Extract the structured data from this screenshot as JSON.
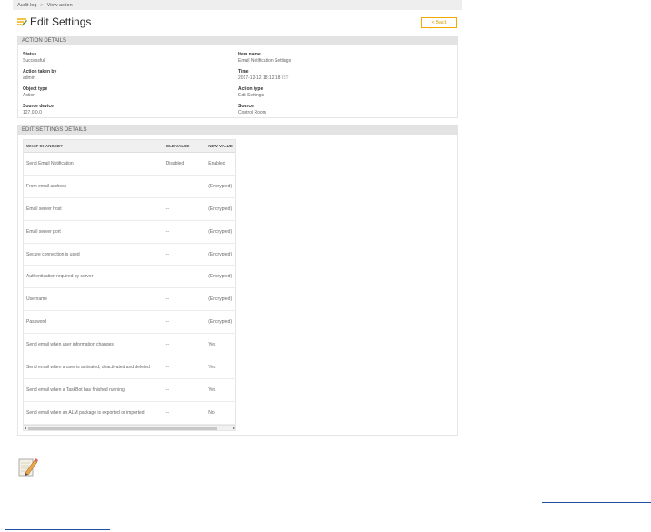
{
  "breadcrumb": {
    "items": [
      "Audit log",
      "View action"
    ],
    "separator": ">"
  },
  "header": {
    "title": "Edit Settings",
    "back_label": "< Back"
  },
  "action_details": {
    "header": "ACTION DETAILS",
    "left": [
      {
        "label": "Status",
        "value": "Successful"
      },
      {
        "label": "Action taken by",
        "value": "admin"
      },
      {
        "label": "Object type",
        "value": "Action"
      },
      {
        "label": "Source device",
        "value": "127.0.0.0"
      }
    ],
    "right": [
      {
        "label": "Item name",
        "value": "Email Notification Settings"
      },
      {
        "label": "Time",
        "value": "2017-12-12 18:12:18",
        "tz": "IST"
      },
      {
        "label": "Action type",
        "value": "Edit Settings"
      },
      {
        "label": "Source",
        "value": "Control Room"
      }
    ]
  },
  "edit_settings": {
    "header": "EDIT SETTINGS DETAILS",
    "columns": [
      "WHAT CHANGED?",
      "OLD VALUE",
      "NEW VALUE"
    ],
    "rows": [
      [
        "Send Email Notification",
        "Disabled",
        "Enabled"
      ],
      [
        "From email address",
        "--",
        "(Encrypted)"
      ],
      [
        "Email server host",
        "--",
        "(Encrypted)"
      ],
      [
        "Email server port",
        "--",
        "(Encrypted)"
      ],
      [
        "Secure connection is used",
        "--",
        "(Encrypted)"
      ],
      [
        "Authentication required by server",
        "--",
        "(Encrypted)"
      ],
      [
        "Username",
        "--",
        "(Encrypted)"
      ],
      [
        "Password",
        "--",
        "(Encrypted)"
      ],
      [
        "Send email when user information changes",
        "--",
        "Yes"
      ],
      [
        "Send email when a user is activated, deactivated and deleted",
        "--",
        "Yes"
      ],
      [
        "Send email when a TaskBot has finished running",
        "--",
        "Yes"
      ],
      [
        "Send email when an ALM package is exported or imported",
        "--",
        "No"
      ]
    ]
  },
  "colors": {
    "accent": "#f2a900",
    "link": "#1f4f9e",
    "section_bg": "#e3e3e3"
  },
  "icons": {
    "title_icon": "edit-settings-icon",
    "note_icon": "pencil-note-icon"
  }
}
